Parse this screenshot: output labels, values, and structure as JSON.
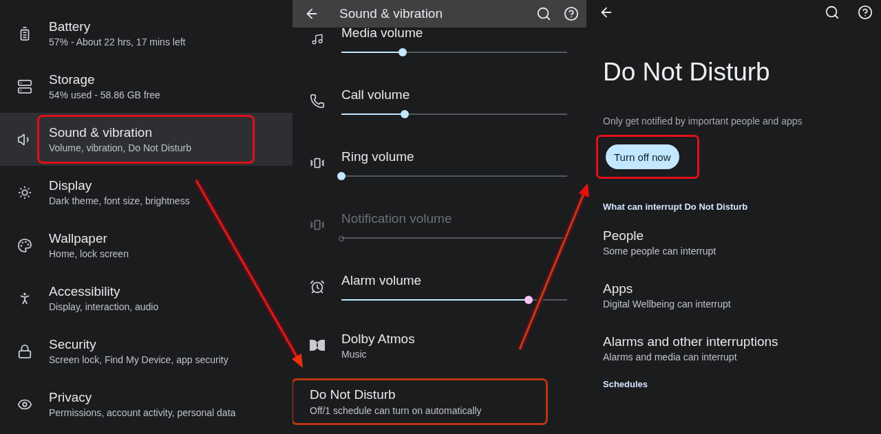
{
  "settings_panel": {
    "items": [
      {
        "title": "Battery",
        "subtitle": "57% - About 22 hrs, 17 mins left",
        "selected": false,
        "highlighted": false
      },
      {
        "title": "Storage",
        "subtitle": "54% used - 58.86 GB free",
        "selected": false,
        "highlighted": false
      },
      {
        "title": "Sound & vibration",
        "subtitle": "Volume, vibration, Do Not Disturb",
        "selected": true,
        "highlighted": true
      },
      {
        "title": "Display",
        "subtitle": "Dark theme, font size, brightness",
        "selected": false,
        "highlighted": false
      },
      {
        "title": "Wallpaper",
        "subtitle": "Home, lock screen",
        "selected": false,
        "highlighted": false
      },
      {
        "title": "Accessibility",
        "subtitle": "Display, interaction, audio",
        "selected": false,
        "highlighted": false
      },
      {
        "title": "Security",
        "subtitle": "Screen lock, Find My Device, app security",
        "selected": false,
        "highlighted": false
      },
      {
        "title": "Privacy",
        "subtitle": "Permissions, account activity, personal data",
        "selected": false,
        "highlighted": false
      }
    ]
  },
  "sound_panel": {
    "title": "Sound & vibration",
    "sliders": [
      {
        "label": "Media volume",
        "level": 0.27,
        "disabled": false,
        "color": "#c2e7ff"
      },
      {
        "label": "Call volume",
        "level": 0.28,
        "disabled": false,
        "color": "#c2e7ff"
      },
      {
        "label": "Ring volume",
        "level": 0,
        "disabled": false,
        "color": "#c2e7ff"
      },
      {
        "label": "Notification volume",
        "level": 0,
        "disabled": true
      },
      {
        "label": "Alarm volume",
        "level": 0.83,
        "disabled": false,
        "color": "#f6c4f4"
      }
    ],
    "items": [
      {
        "kind": "icon",
        "title": "Dolby Atmos",
        "subtitle": "Music",
        "highlighted": false
      },
      {
        "kind": "plain",
        "title": "Do Not Disturb",
        "subtitle": "Off/1 schedule can turn on automatically",
        "highlighted": true
      }
    ]
  },
  "dnd_panel": {
    "title": "Do Not Disturb",
    "description": "Only get notified by important people and apps",
    "button": {
      "label": "Turn off now",
      "highlighted": true
    },
    "sections": [
      {
        "header": "What can interrupt Do Not Disturb",
        "items": [
          {
            "title": "People",
            "subtitle": "Some people can interrupt"
          },
          {
            "title": "Apps",
            "subtitle": "Digital Wellbeing can interrupt"
          },
          {
            "title": "Alarms and other interruptions",
            "subtitle": "Alarms and media can interrupt"
          }
        ]
      },
      {
        "header": "Schedules"
      }
    ]
  }
}
